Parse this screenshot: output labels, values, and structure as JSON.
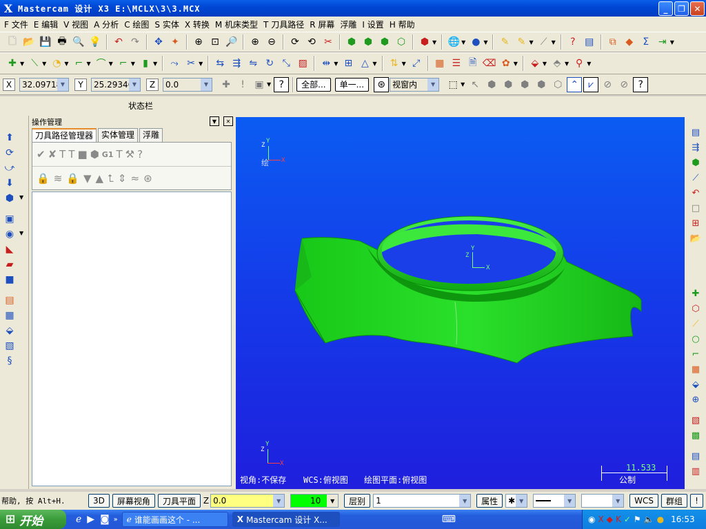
{
  "window": {
    "title": "Mastercam 设计 X3  E:\\MCLX\\3\\3.MCX",
    "logo": "X"
  },
  "menu": [
    "F 文件",
    "E 编辑",
    "V 视图",
    "A 分析",
    "C 绘图",
    "S 实体",
    "X 转换",
    "M 机床类型",
    "T 刀具路径",
    "R 屏幕",
    "浮雕",
    "I 设置",
    "H 帮助"
  ],
  "coords": {
    "x_label": "X",
    "x_value": "32.09718",
    "y_label": "Y",
    "y_value": "25.29346",
    "z_label": "Z",
    "z_value": "0.0"
  },
  "ribbon_buttons": {
    "all": "全部...",
    "single": "单一...",
    "window_mode": "视窗内"
  },
  "status_title": "状态栏",
  "panel": {
    "title": "操作管理",
    "tabs": [
      "刀具路径管理器",
      "实体管理",
      "浮雕"
    ],
    "g1": "G1"
  },
  "viewport": {
    "top_triad": {
      "y": "Y",
      "z": "Z",
      "x": "X",
      "caption": "绘"
    },
    "center_triad": {
      "y": "Y",
      "z": "Z",
      "x": "X"
    },
    "bottom_triad": {
      "y": "Y",
      "z": "Z",
      "x": "X"
    },
    "status": {
      "view": "视角:不保存",
      "wcs": "WCS:俯视图",
      "plane": "绘图平面:俯视图"
    },
    "scale": {
      "value": "11.533",
      "unit": "公制"
    }
  },
  "bottombar": {
    "help": "帮助, 按 Alt+H.",
    "btn_3d": "3D",
    "btn_view": "屏幕视角",
    "btn_plane": "刀具平面",
    "z_label": "Z",
    "z_value": "0.0",
    "color_value": "10",
    "layer_label": "层别",
    "layer_value": "1",
    "attr": "属性",
    "wcs": "WCS",
    "group": "群组",
    "help_btn": "!"
  },
  "taskbar": {
    "start": "开始",
    "tasks": [
      "谁能画画这个 - ...",
      "Mastercam 设计 X..."
    ],
    "time": "16:53"
  },
  "colors": {
    "viewport_top": "#0b5cf2",
    "viewport_bottom": "#1f1fdd",
    "part": "#1ecf1e",
    "title_bar": "#0048d6"
  }
}
